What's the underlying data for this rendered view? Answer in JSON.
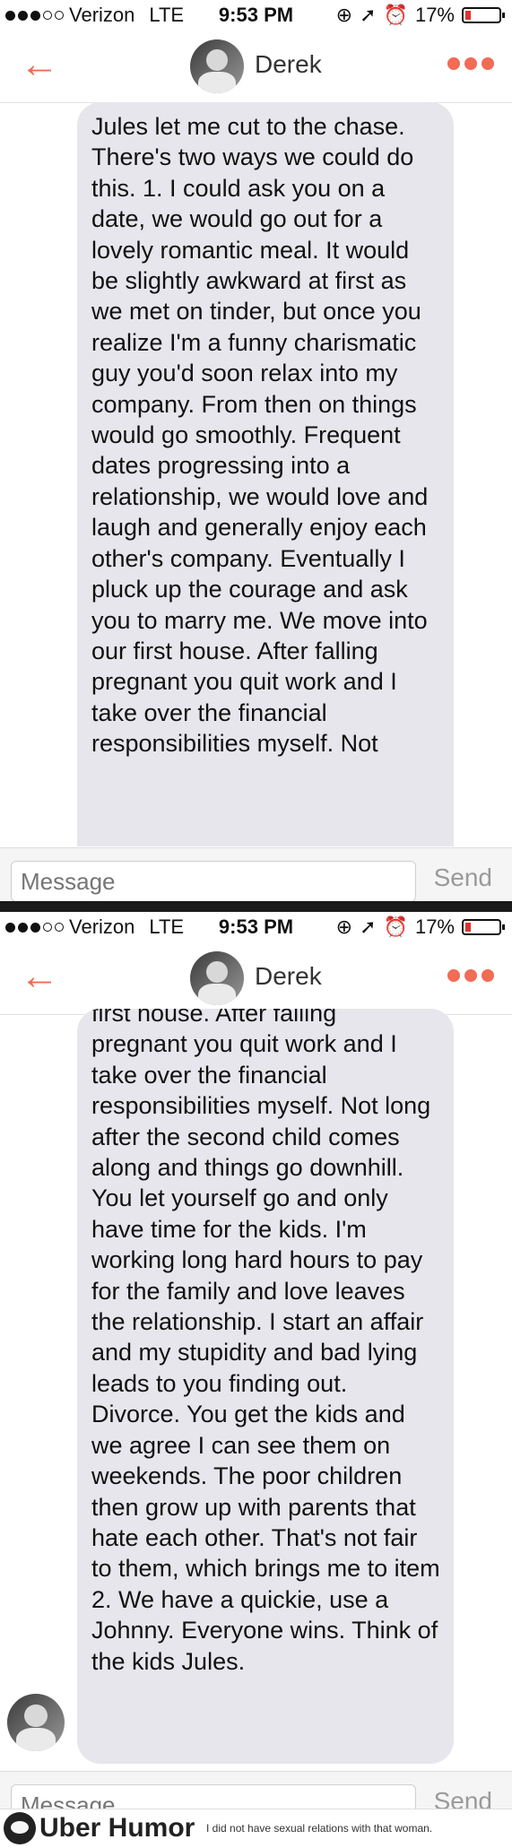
{
  "status": {
    "carrier": "Verizon",
    "network": "LTE",
    "time": "9:53 PM",
    "battery": "17%",
    "battery_level": 0.17
  },
  "nav": {
    "back_icon": "arrow-left-icon",
    "contact_name": "Derek",
    "more_icon": "more-dots-icon",
    "accent_color": "#f26b55"
  },
  "screen1": {
    "message": "Jules let me cut to the chase. There's two ways we could do this. 1. I could ask you on a date, we would go out for a lovely romantic meal. It would be slightly awkward at first as we met on tinder, but once you realize I'm a funny charismatic guy you'd soon relax into my company. From then on things would go smoothly. Frequent dates progressing into a relationship, we would love and laugh and generally enjoy each other's company. Eventually I pluck up the courage and ask you to marry me. We move into our first house. After falling pregnant you quit work and I take over the financial responsibilities myself. Not"
  },
  "screen2": {
    "message_partial_top": "first house. After falling",
    "message": "pregnant you quit work and I take over the financial responsibilities myself. Not long after the second child comes along and things go downhill. You let yourself go and only have time for the kids. I'm working long hard hours to pay for the family and love leaves the relationship. I start an affair and my stupidity and bad lying leads to you finding out. Divorce. You get the kids and we agree I can see them on weekends. The poor children then grow up with parents that hate each other. That's not fair to them, which brings me to item 2. We have a quickie, use a Johnny. Everyone wins. Think of the kids Jules."
  },
  "input": {
    "placeholder": "Message",
    "send_label": "Send"
  },
  "footer": {
    "brand": "Uber Humor",
    "tagline": "I did not have sexual relations with that woman."
  }
}
